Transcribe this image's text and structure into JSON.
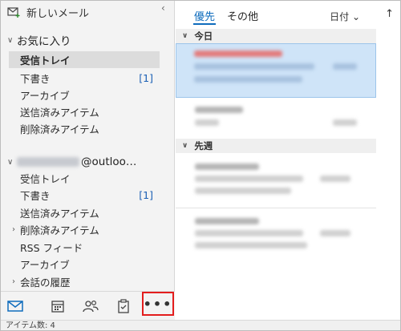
{
  "left": {
    "new_mail": "新しいメール",
    "favorites_header": "お気に入り",
    "favorites": [
      {
        "label": "受信トレイ",
        "count": ""
      },
      {
        "label": "下書き",
        "count": "[1]"
      },
      {
        "label": "アーカイブ",
        "count": ""
      },
      {
        "label": "送信済みアイテム",
        "count": ""
      },
      {
        "label": "削除済みアイテム",
        "count": ""
      }
    ],
    "account_suffix": "@outloo…",
    "account_items": [
      {
        "label": "受信トレイ",
        "count": ""
      },
      {
        "label": "下書き",
        "count": "[1]"
      },
      {
        "label": "送信済みアイテム",
        "count": ""
      },
      {
        "label": "削除済みアイテム",
        "count": ""
      },
      {
        "label": "RSS フィード",
        "count": ""
      },
      {
        "label": "アーカイブ",
        "count": ""
      },
      {
        "label": "会話の履歴",
        "count": ""
      }
    ],
    "more_label": "•••"
  },
  "right": {
    "tab_focused": "優先",
    "tab_other": "その他",
    "sort_label": "日付 ⌄",
    "sort_dir": "↑",
    "section_today": "今日",
    "section_last_week": "先週"
  },
  "status": {
    "item_count": "アイテム数: 4"
  },
  "colors": {
    "accent": "#0f6cbd",
    "highlight": "#e31d1d",
    "selected_bg": "#cfe4f8"
  }
}
